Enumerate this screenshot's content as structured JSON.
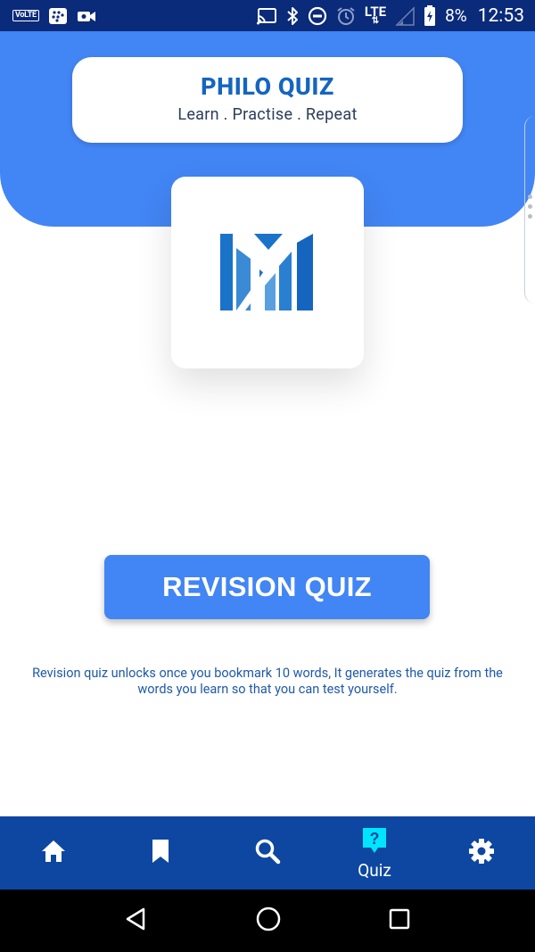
{
  "status_bar": {
    "volte_label": "VoLTE",
    "network_label": "LTE",
    "battery_percent": "8%",
    "time": "12:53"
  },
  "header": {
    "title": "PHILO QUIZ",
    "subtitle": "Learn . Practise . Repeat"
  },
  "logo": {
    "icon": "app-logo-icon"
  },
  "main": {
    "revision_button_label": "REVISION QUIZ",
    "info_text": "Revision quiz unlocks once you bookmark 10 words, It generates the quiz from the words you learn so that you can test yourself."
  },
  "bottom_nav": {
    "items": [
      {
        "icon": "home-icon",
        "label": ""
      },
      {
        "icon": "bookmark-icon",
        "label": ""
      },
      {
        "icon": "search-icon",
        "label": ""
      },
      {
        "icon": "quiz-icon",
        "label": "Quiz",
        "active": true
      },
      {
        "icon": "gear-icon",
        "label": ""
      }
    ]
  },
  "colors": {
    "primary": "#4285f4",
    "nav_bg": "#0d47a1",
    "status_bg": "#0a2a7a",
    "active_icon": "#00e5ff",
    "title_text": "#1565c0",
    "info_text": "#1f5aa6"
  }
}
